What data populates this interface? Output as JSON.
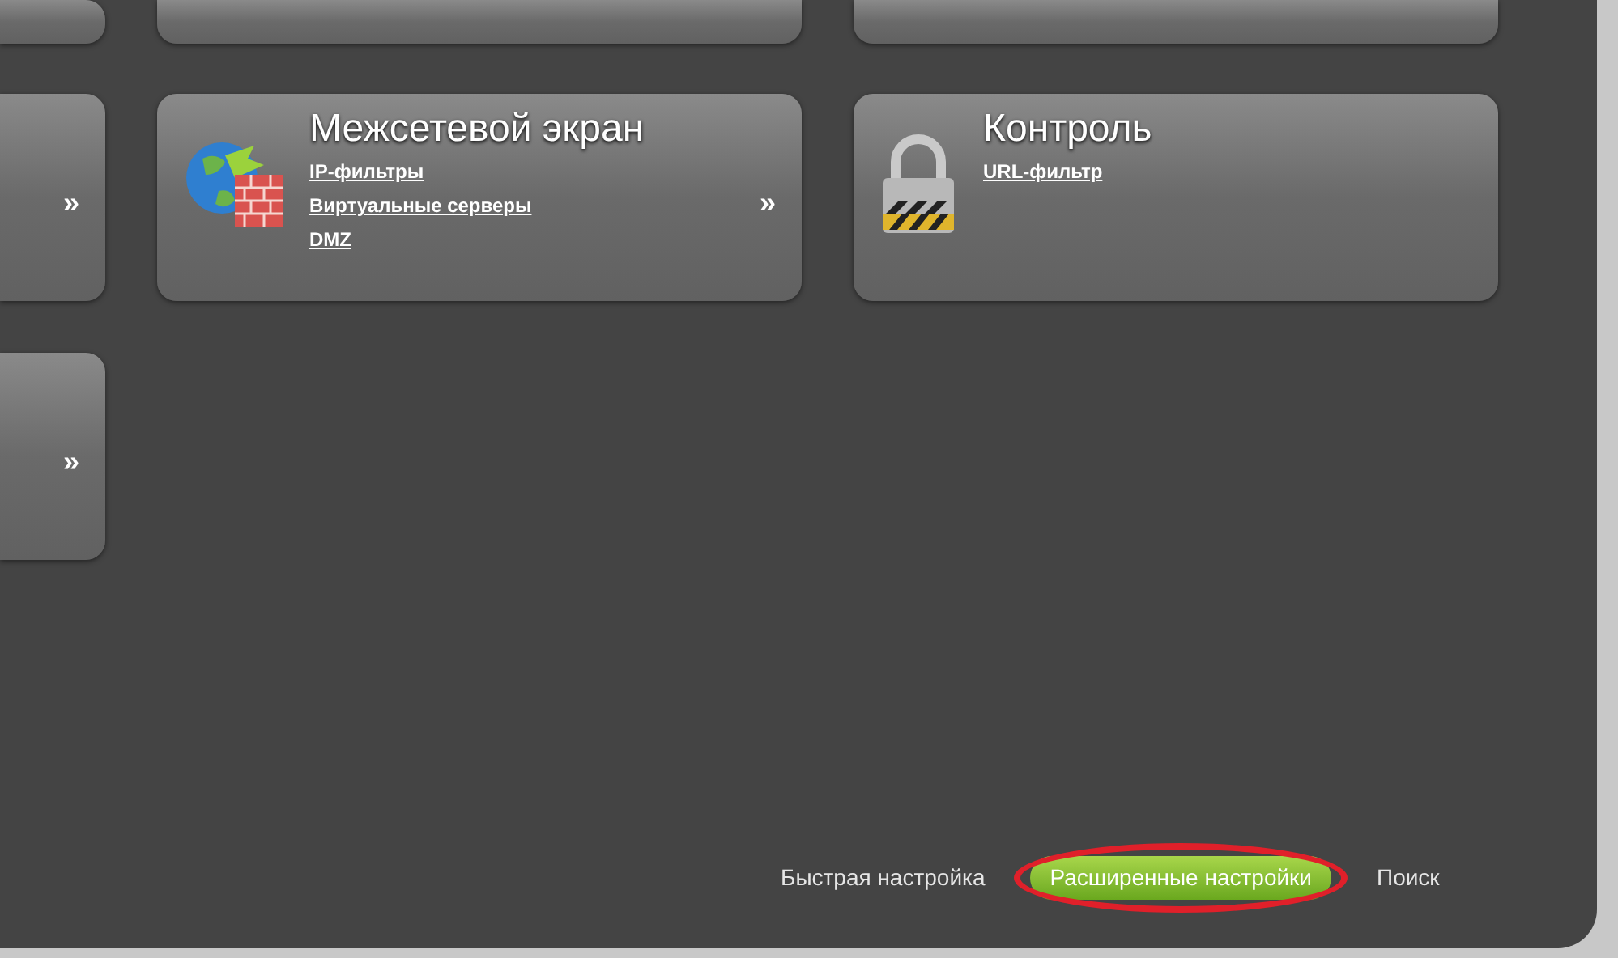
{
  "rows": [
    {
      "cards": [
        {
          "kind": "partial"
        },
        {
          "kind": "blank"
        },
        {
          "kind": "blank"
        }
      ]
    },
    {
      "cards": [
        {
          "kind": "partial",
          "chevron": "»"
        },
        {
          "kind": "firewall",
          "title": "Межсетевой экран",
          "links": [
            "IP-фильтры",
            "Виртуальные серверы",
            "DMZ"
          ],
          "chevron": "»"
        },
        {
          "kind": "lock",
          "title": "Контроль",
          "links": [
            "URL-фильтр"
          ]
        }
      ]
    },
    {
      "cards": [
        {
          "kind": "partial",
          "chevron": "»"
        }
      ]
    }
  ],
  "footer": [
    {
      "label": "Быстрая настройка",
      "selected": false,
      "circled": false
    },
    {
      "label": "Расширенные настройки",
      "selected": true,
      "circled": true
    },
    {
      "label": "Поиск",
      "selected": false,
      "circled": false
    }
  ]
}
